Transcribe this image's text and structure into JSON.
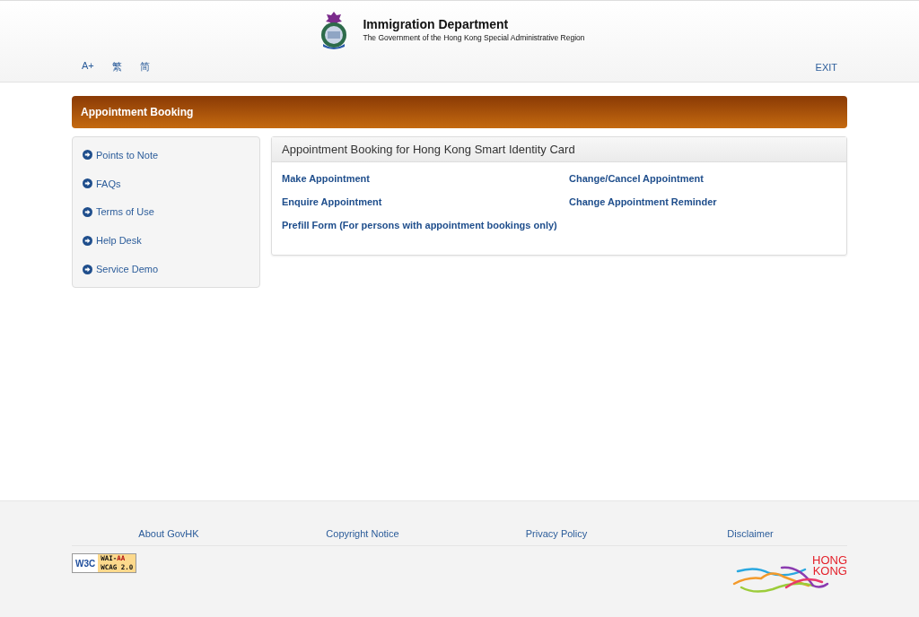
{
  "header": {
    "title": "Immigration Department",
    "subtitle": "The Government of the Hong Kong Special Administrative Region",
    "tools": [
      "A+",
      "繁",
      "简"
    ],
    "exit": "EXIT"
  },
  "banner": {
    "title": "Appointment Booking"
  },
  "sidebar": {
    "items": [
      "Points to Note",
      "FAQs",
      "Terms of Use",
      "Help Desk",
      "Service Demo"
    ]
  },
  "panel": {
    "title": "Appointment Booking for Hong Kong Smart Identity Card",
    "links": [
      "Make Appointment",
      "Change/Cancel Appointment",
      "Enquire Appointment",
      "Change Appointment Reminder",
      "Prefill Form (For persons with appointment bookings only)"
    ]
  },
  "footer": {
    "links": [
      "About GovHK",
      "Copyright Notice",
      "Privacy Policy",
      "Disclaimer"
    ],
    "badge": {
      "logo": "W3C",
      "conformance_prefix": "WAI-",
      "conformance": "AA",
      "standard": "WCAG 2.0"
    },
    "brand_lines": [
      "HONG",
      "KONG"
    ]
  }
}
